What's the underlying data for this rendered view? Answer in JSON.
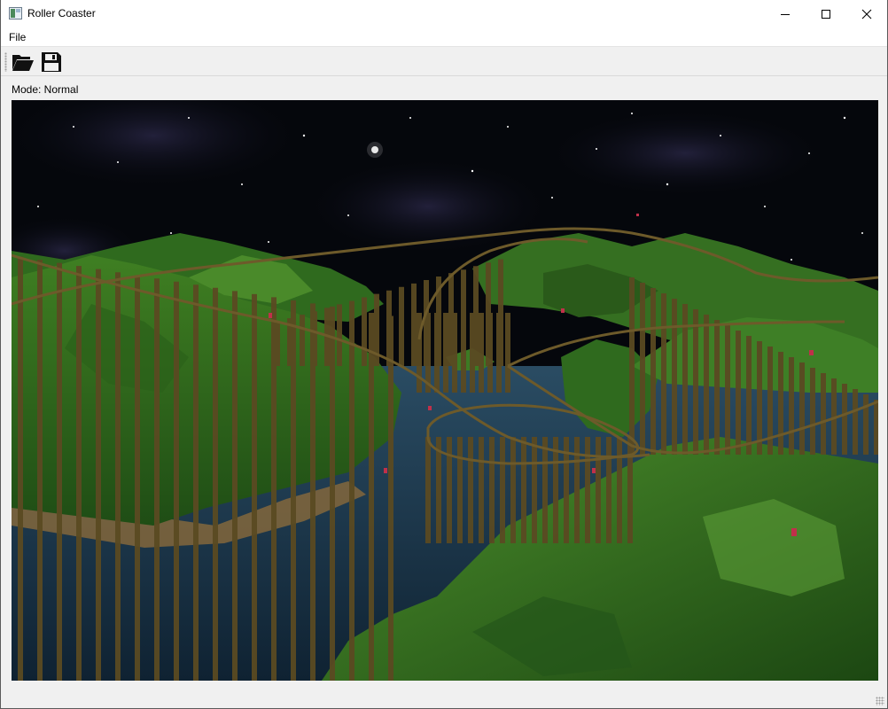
{
  "window": {
    "title": "Roller Coaster",
    "controls": [
      "minimize",
      "maximize",
      "close"
    ]
  },
  "menubar": {
    "items": [
      {
        "label": "File"
      }
    ]
  },
  "toolbar": {
    "buttons": [
      {
        "name": "open",
        "icon": "folder-open-icon"
      },
      {
        "name": "save",
        "icon": "floppy-disk-icon"
      }
    ]
  },
  "status": {
    "mode_text": "Mode: Normal"
  },
  "viewport": {
    "description_icon": "3d-scene",
    "colors": {
      "sky": "#05070c",
      "terrain": "#2f6a1e",
      "water": "#1b3447",
      "track": "#5a4a22"
    }
  }
}
